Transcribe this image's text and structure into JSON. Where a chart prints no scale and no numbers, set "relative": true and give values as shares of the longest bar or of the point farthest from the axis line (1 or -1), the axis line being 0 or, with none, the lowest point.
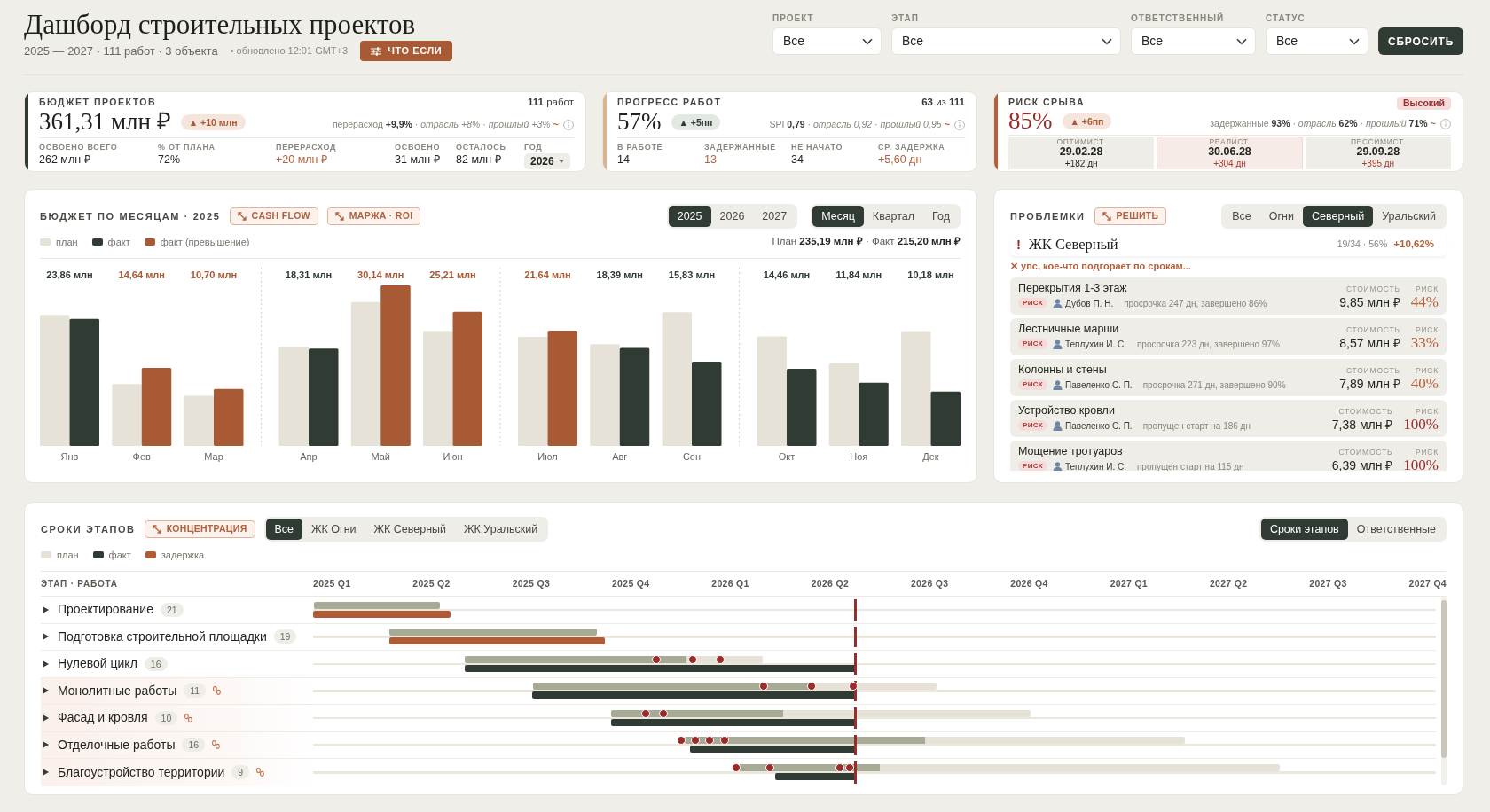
{
  "header": {
    "title": "Дашборд строительных проектов",
    "subtitle": "2025 — 2027 · 111 работ · 3 объекта",
    "updated": "• обновлено 12:01 GMT+3",
    "what_if_button": "ЧТО ЕСЛИ"
  },
  "filters": [
    {
      "label": "ПРОЕКТ",
      "value": "Все"
    },
    {
      "label": "ЭТАП",
      "value": "Все"
    },
    {
      "label": "ОТВЕТСТВЕННЫЙ",
      "value": "Все"
    },
    {
      "label": "СТАТУС",
      "value": "Все"
    }
  ],
  "reset_button": "СБРОСИТЬ",
  "kpis": [
    {
      "kind": "budget",
      "color": "#2f3b33",
      "title": "БЮДЖЕТ ПРОЕКТОВ",
      "count": "**111** работ",
      "value": "361,31 млн ₽",
      "value_alert": false,
      "delta": "▲ +10 млн",
      "delta_good": false,
      "comparison": "перерасход **+9,9%** · *отрасль +8%* · *прошлый +3%*",
      "trend": "~",
      "metrics": [
        {
          "kind": "value",
          "label": "ОСВОЕНО ВСЕГО",
          "value": "262 млн ₽",
          "warning": false
        },
        {
          "kind": "value",
          "label": "% ОТ ПЛАНА",
          "value": "72%",
          "warning": false
        },
        {
          "kind": "value",
          "label": "ПЕРЕРАСХОД",
          "value": "+20 млн ₽",
          "warning": true
        },
        {
          "kind": "value",
          "label": "ОСВОЕНО",
          "value": "31 млн ₽",
          "warning": false
        },
        {
          "kind": "value",
          "label": "ОСТАЛОСЬ",
          "value": "82 млн ₽",
          "warning": false
        },
        {
          "kind": "select",
          "label": "ГОД",
          "value": "2026",
          "warning": false
        }
      ]
    },
    {
      "kind": "progress",
      "color": "#d9b48f",
      "title": "ПРОГРЕСС РАБОТ",
      "count": "**63** из **111**",
      "value": "57%",
      "value_alert": false,
      "delta": "▲ +5пп",
      "delta_good": true,
      "comparison": "SPI **0,79** · *отрасль 0,92* · *прошлый 0,95*",
      "trend": "~",
      "metrics": [
        {
          "kind": "value",
          "label": "В РАБОТЕ",
          "value": "14",
          "warning": false
        },
        {
          "kind": "value",
          "label": "ЗАДЕРЖАННЫЕ",
          "value": "13",
          "warning": true
        },
        {
          "kind": "value",
          "label": "НЕ НАЧАТО",
          "value": "34",
          "warning": false
        },
        {
          "kind": "value",
          "label": "СР. ЗАДЕРЖКА",
          "value": "+5,60 дн",
          "warning": true
        }
      ]
    },
    {
      "kind": "risk",
      "color": "#b5603a",
      "title": "РИСК СРЫВА",
      "level_badge": "Высокий",
      "value": "85%",
      "value_alert": true,
      "delta": "▲ +6пп",
      "delta_good": false,
      "comparison": "задержанные **93%** · *отрасль* **62%** · *прошлый* **71%**",
      "trend": "~",
      "scenarios": [
        {
          "label": "ОПТИМИСТ.",
          "date": "29.02.28",
          "delta": "+182 дн",
          "warning": false,
          "selected": false
        },
        {
          "label": "РЕАЛИСТ.",
          "date": "30.06.28",
          "delta": "+304 дн",
          "warning": true,
          "selected": true
        },
        {
          "label": "ПЕССИМИСТ.",
          "date": "29.09.28",
          "delta": "+395 дн",
          "warning": true,
          "selected": false
        }
      ]
    }
  ],
  "budget_chart": {
    "title": "БЮДЖЕТ ПО МЕСЯЦАМ · 2025",
    "actions": [
      "CASH FLOW",
      "МАРЖА · ROI"
    ],
    "years": [
      {
        "label": "2025",
        "selected": true
      },
      {
        "label": "2026",
        "selected": false
      },
      {
        "label": "2027",
        "selected": false
      }
    ],
    "periods": [
      {
        "label": "Месяц",
        "selected": true
      },
      {
        "label": "Квартал",
        "selected": false
      },
      {
        "label": "Год",
        "selected": false
      }
    ],
    "totals": "План **235,19 млн ₽** · Факт **215,20 млн ₽**",
    "chart_data": {
      "type": "bar",
      "relative": true,
      "categories": [
        "Янв",
        "Фев",
        "Мар",
        "Апр",
        "Май",
        "Июн",
        "Июл",
        "Авг",
        "Сен",
        "Окт",
        "Ноя",
        "Дек"
      ],
      "series": [
        {
          "name": "план",
          "color": "#e6e2d7",
          "values": [
            0.816,
            0.385,
            0.312,
            0.617,
            0.896,
            0.717,
            0.68,
            0.634,
            0.833,
            0.683,
            0.514,
            0.716
          ]
        },
        {
          "name": "факт",
          "color": "#2f3b33",
          "values": [
            0.792,
            null,
            null,
            0.607,
            null,
            null,
            null,
            0.61,
            0.525,
            0.48,
            0.393,
            0.338
          ]
        },
        {
          "name": "факт (превышение)",
          "color": "#a85a34",
          "values": [
            null,
            0.486,
            0.355,
            null,
            1.0,
            0.836,
            0.718,
            null,
            null,
            null,
            null,
            null
          ]
        }
      ],
      "value_labels": [
        "23,86 млн",
        "14,64 млн",
        "10,70 млн",
        "18,31 млн",
        "30,14 млн",
        "25,21 млн",
        "21,64 млн",
        "18,39 млн",
        "15,83 млн",
        "14,46 млн",
        "11,84 млн",
        "10,18 млн"
      ]
    }
  },
  "problems": {
    "title": "ПРОБЛЕМКИ",
    "action": "РЕШИТЬ",
    "tabs": [
      {
        "label": "Все",
        "selected": false
      },
      {
        "label": "Огни",
        "selected": false
      },
      {
        "label": "Северный",
        "selected": true
      },
      {
        "label": "Уральский",
        "selected": false
      }
    ],
    "project": {
      "mark": "!",
      "name": "ЖК Северный",
      "stats": "19/34 · 56%",
      "delta": "+10,62%"
    },
    "alert": "✕ упс, кое-что подгорает по срокам...",
    "items": [
      {
        "name": "Перекрытия 1-3 этаж",
        "tag": "РИСК",
        "assignee": "Дубов П. Н.",
        "note": "просрочка 247 дн, завершено 86%",
        "cost_label": "СТОИМОСТЬ",
        "cost": "9,85 млн ₽",
        "risk_label": "РИСК",
        "risk": "44%",
        "color": "#b5603a"
      },
      {
        "name": "Лестничные марши",
        "tag": "РИСК",
        "assignee": "Теплухин И. С.",
        "note": "просрочка 223 дн, завершено 97%",
        "cost_label": "СТОИМОСТЬ",
        "cost": "8,57 млн ₽",
        "risk_label": "РИСК",
        "risk": "33%",
        "color": "#b5603a"
      },
      {
        "name": "Колонны и стены",
        "tag": "РИСК",
        "assignee": "Павеленко С. П.",
        "note": "просрочка 271 дн, завершено 90%",
        "cost_label": "СТОИМОСТЬ",
        "cost": "7,89 млн ₽",
        "risk_label": "РИСК",
        "risk": "40%",
        "color": "#b5603a"
      },
      {
        "name": "Устройство кровли",
        "tag": "РИСК",
        "assignee": "Павеленко С. П.",
        "note": "пропущен старт на 186 дн",
        "cost_label": "СТОИМОСТЬ",
        "cost": "7,38 млн ₽",
        "risk_label": "РИСК",
        "risk": "100%",
        "color": "#9b2c2c"
      },
      {
        "name": "Мощение тротуаров",
        "tag": "РИСК",
        "assignee": "Теплухин И. С.",
        "note": "пропущен старт на 115 дн",
        "cost_label": "СТОИМОСТЬ",
        "cost": "6,39 млн ₽",
        "risk_label": "РИСК",
        "risk": "100%",
        "color": "#9b2c2c"
      }
    ]
  },
  "timeline": {
    "title": "СРОКИ ЭТАПОВ",
    "action": "КОНЦЕНТРАЦИЯ",
    "filters": [
      {
        "label": "Все",
        "selected": true
      },
      {
        "label": "ЖК Огни",
        "selected": false
      },
      {
        "label": "ЖК Северный",
        "selected": false
      },
      {
        "label": "ЖК Уральский",
        "selected": false
      }
    ],
    "views": [
      {
        "label": "Сроки этапов",
        "selected": true
      },
      {
        "label": "Ответственные",
        "selected": false
      }
    ],
    "legend": [
      {
        "label": "план",
        "color": "#e6e2d7"
      },
      {
        "label": "факт",
        "color": "#2f3b33"
      },
      {
        "label": "задержка",
        "color": "#b05b36"
      }
    ],
    "column_header": "ЭТАП · РАБОТА",
    "quarters": [
      "2025 Q1",
      "2025 Q2",
      "2025 Q3",
      "2025 Q4",
      "2026 Q1",
      "2026 Q2",
      "2026 Q3",
      "2026 Q4",
      "2027 Q1",
      "2027 Q2",
      "2027 Q3",
      "2027 Q4"
    ],
    "rows": [
      {
        "kind": "done",
        "name": "Проектирование",
        "count": "21",
        "expanded": false,
        "linked": false
      },
      {
        "kind": "done",
        "name": "Подготовка строительной площадки",
        "count": "19",
        "expanded": false,
        "linked": false
      },
      {
        "kind": "active",
        "name": "Нулевой цикл",
        "count": "16",
        "expanded": false,
        "linked": false,
        "level": 0.74
      },
      {
        "kind": "active",
        "name": "Монолитные работы",
        "count": "11",
        "expanded": false,
        "linked": true,
        "level": 0.69
      },
      {
        "kind": "active",
        "name": "Фасад и кровля",
        "count": "10",
        "expanded": false,
        "linked": true,
        "level": 0.41
      },
      {
        "kind": "active",
        "name": "Отделочные работы",
        "count": "16",
        "expanded": false,
        "linked": true,
        "level": 0.48
      },
      {
        "kind": "active",
        "name": "Благоустройство территории",
        "count": "9",
        "expanded": false,
        "linked": true,
        "level": 0.26
      }
    ]
  }
}
